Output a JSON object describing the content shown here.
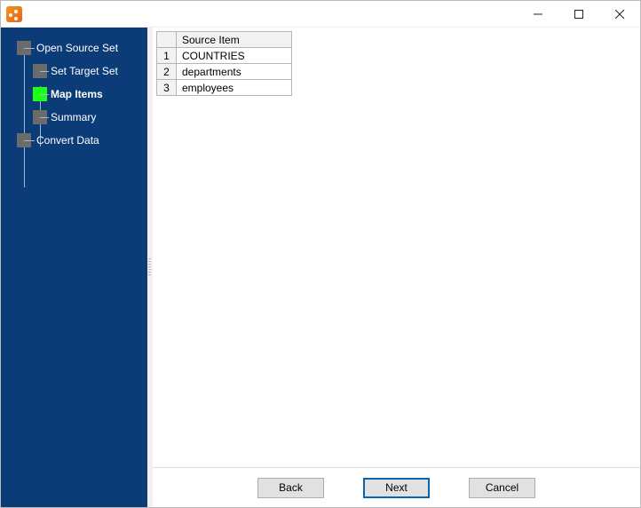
{
  "sidebar": {
    "items": [
      {
        "label": "Open Source Set",
        "level": 0,
        "active": false
      },
      {
        "label": "Set Target Set",
        "level": 1,
        "active": false
      },
      {
        "label": "Map Items",
        "level": 1,
        "active": true
      },
      {
        "label": "Summary",
        "level": 1,
        "active": false
      },
      {
        "label": "Convert Data",
        "level": 0,
        "active": false
      }
    ]
  },
  "table": {
    "header": "Source Item",
    "rows": [
      {
        "n": "1",
        "val": "COUNTRIES"
      },
      {
        "n": "2",
        "val": "departments"
      },
      {
        "n": "3",
        "val": "employees"
      }
    ]
  },
  "buttons": {
    "back": "Back",
    "next": "Next",
    "cancel": "Cancel"
  }
}
